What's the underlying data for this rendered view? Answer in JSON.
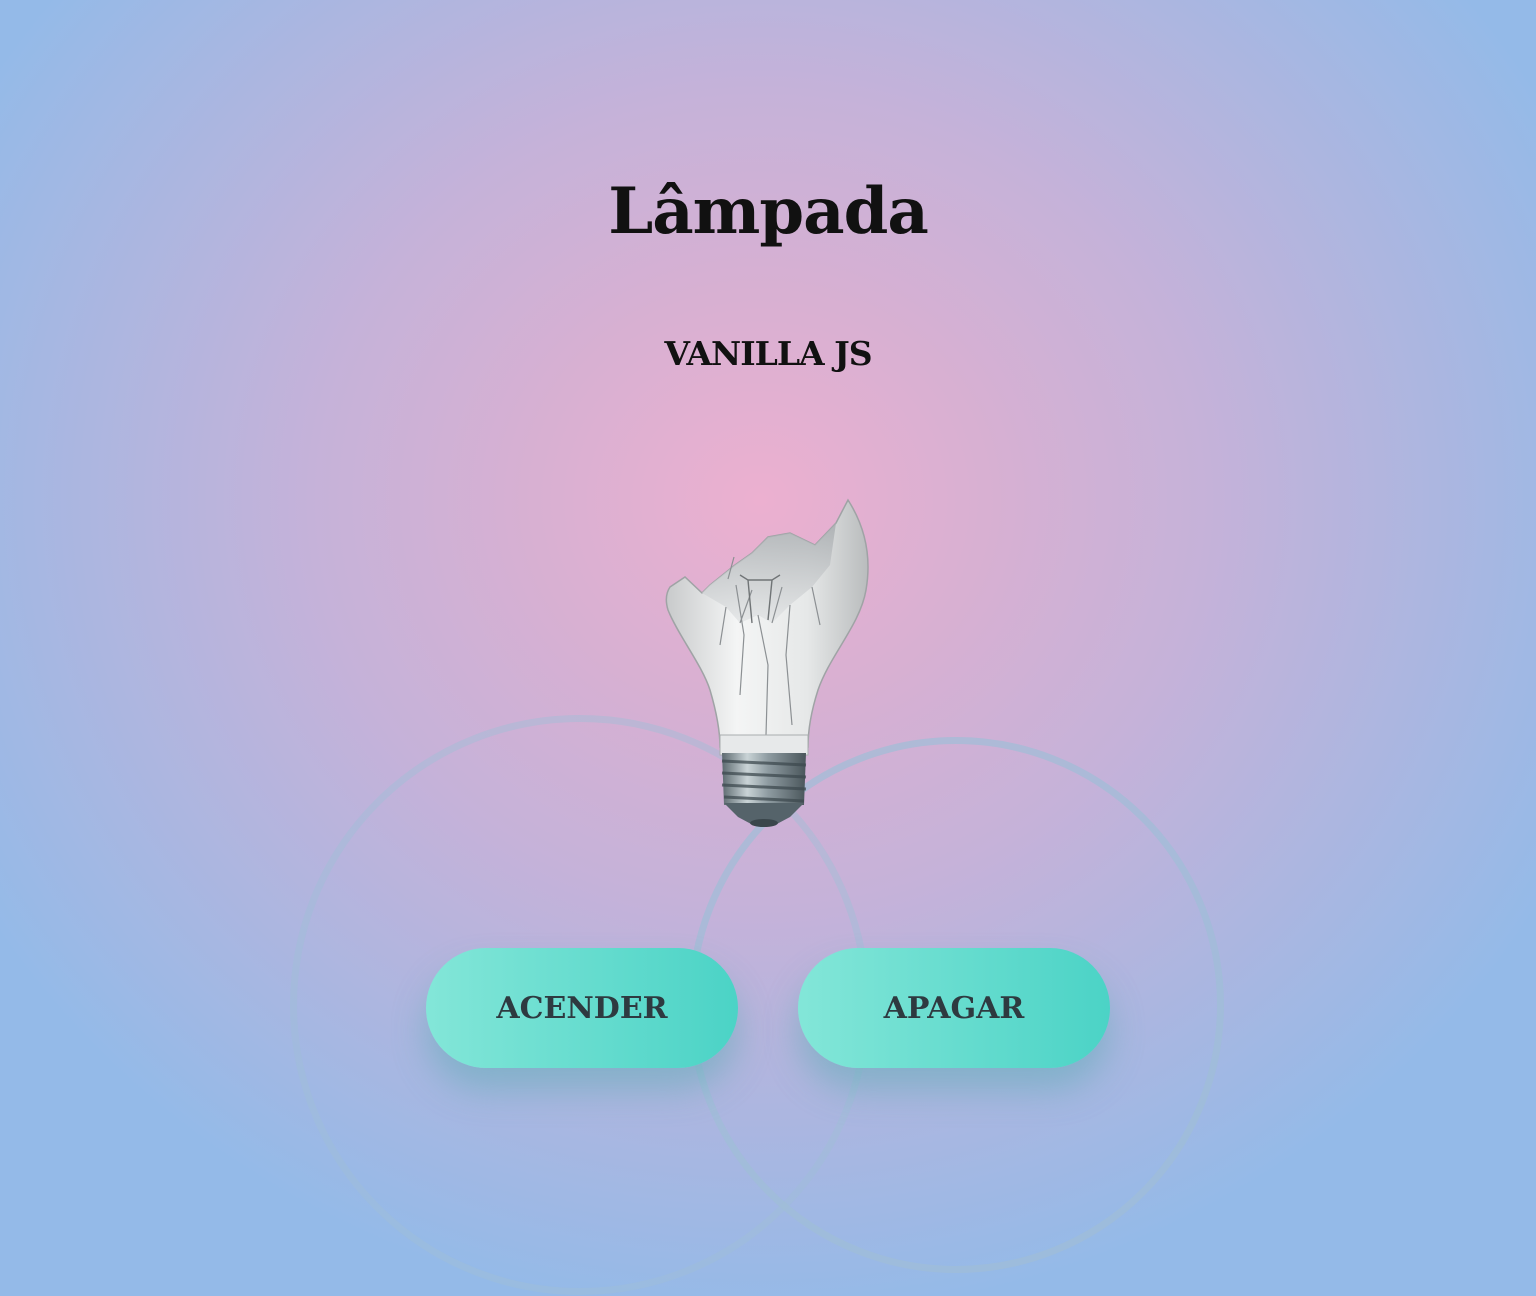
{
  "header": {
    "title": "Lâmpada",
    "subtitle": "VANILLA JS"
  },
  "bulb": {
    "icon": "broken-lightbulb-icon",
    "state": "broken"
  },
  "controls": {
    "on_label": "ACENDER",
    "off_label": "APAGAR"
  },
  "colors": {
    "button_start": "#83e6d8",
    "button_end": "#4bd3c6",
    "button_text": "#2e3a40",
    "background_center": "#ecb0d0",
    "background_edge": "#94bae8"
  }
}
